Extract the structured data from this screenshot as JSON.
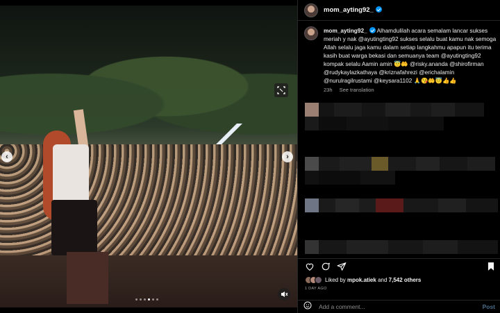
{
  "post": {
    "username": "mom_ayting92_",
    "verified": true
  },
  "caption": {
    "username": "mom_ayting92_",
    "text": "Alhamdulilah acara semalam lancar sukses meriah y nak @ayutingting92 sukses selalu buat kamu nak semoga Allah selalu jaga kamu dalam setiap langkahmu apapun itu terima kasih buat warga bekasi dan semuanya team @ayutingting92 kompak selalu Aamin amin 😇🤲 @risky.ananda @shirofirman @rudykaylazkathaya @kriznafahrezi @erichalamin @nurulragilrustami @keysara1102 🙏😘🤲😇👍👍",
    "time": "23h",
    "see_translation": "See translation"
  },
  "actions": {
    "like_icon": "heart-icon",
    "comment_icon": "comment-icon",
    "share_icon": "share-icon",
    "save_icon": "bookmark-icon"
  },
  "likes": {
    "prefix": "Liked by",
    "user": "mpok.atiek",
    "connector": "and",
    "others": "7,542 others"
  },
  "date": "1 DAY AGO",
  "add_comment": {
    "placeholder": "Add a comment...",
    "post_label": "Post"
  },
  "colors": {
    "accent": "#0095f6",
    "background": "#000000",
    "divider": "#262626",
    "muted_text": "#a8a8a8"
  }
}
